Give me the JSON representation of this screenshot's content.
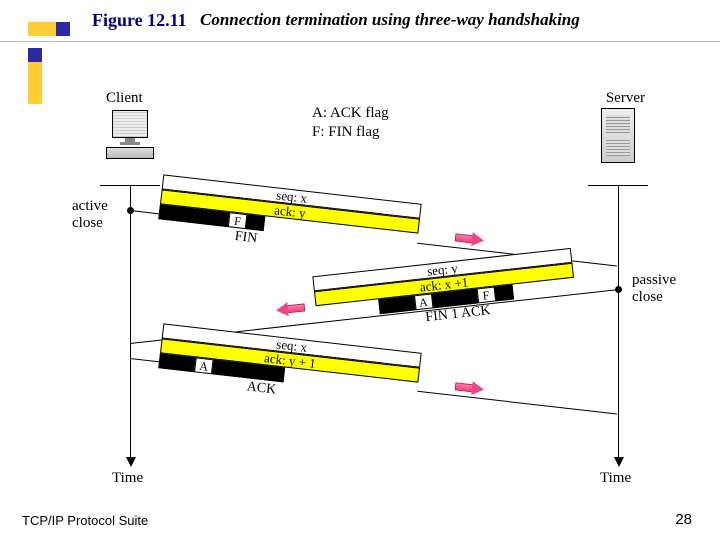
{
  "figure": {
    "number": "Figure 12.11",
    "title": "Connection termination using three-way handshaking"
  },
  "legend": {
    "a": "A: ACK flag",
    "f": "F: FIN flag"
  },
  "endpoints": {
    "client": "Client",
    "server": "Server"
  },
  "close_labels": {
    "active1": "active",
    "active2": "close",
    "passive1": "passive",
    "passive2": "close"
  },
  "time_label": "Time",
  "segments": {
    "fin": {
      "seq": "seq: x",
      "ack": "ack: y",
      "flag_f": "F",
      "name": "FIN"
    },
    "finack": {
      "seq": "seq: y",
      "ack": "ack: x +1",
      "flag_a": "A",
      "flag_f": "F",
      "name": "FIN 1 ACK"
    },
    "ack": {
      "seq": "seq: x",
      "ack": "ack: y + 1",
      "flag_a": "A",
      "name": "ACK"
    }
  },
  "footer": {
    "left": "TCP/IP Protocol Suite",
    "page": "28"
  }
}
